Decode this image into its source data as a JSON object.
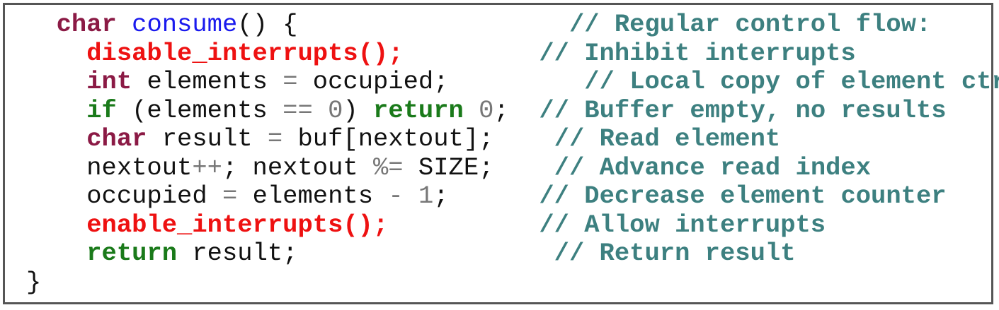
{
  "code_lines": [
    {
      "segments": [
        {
          "text": "  ",
          "kind": "plain"
        },
        {
          "text": "char",
          "kind": "kw-type"
        },
        {
          "text": " ",
          "kind": "plain"
        },
        {
          "text": "consume",
          "kind": "fn-name"
        },
        {
          "text": "() {                  ",
          "kind": "plain"
        },
        {
          "text": "// Regular control flow:",
          "kind": "comment"
        }
      ]
    },
    {
      "segments": [
        {
          "text": "    ",
          "kind": "plain"
        },
        {
          "text": "disable_interrupts();",
          "kind": "fn-red"
        },
        {
          "text": "         ",
          "kind": "plain"
        },
        {
          "text": "// Inhibit interrupts",
          "kind": "comment"
        }
      ]
    },
    {
      "segments": [
        {
          "text": "    ",
          "kind": "plain"
        },
        {
          "text": "int",
          "kind": "kw-type"
        },
        {
          "text": " elements ",
          "kind": "plain"
        },
        {
          "text": "=",
          "kind": "op"
        },
        {
          "text": " occupied;         ",
          "kind": "plain"
        },
        {
          "text": "// Local copy of element ctr",
          "kind": "comment"
        }
      ]
    },
    {
      "segments": [
        {
          "text": "    ",
          "kind": "plain"
        },
        {
          "text": "if",
          "kind": "kw-ctrl"
        },
        {
          "text": " (elements ",
          "kind": "plain"
        },
        {
          "text": "==",
          "kind": "op"
        },
        {
          "text": " ",
          "kind": "plain"
        },
        {
          "text": "0",
          "kind": "num"
        },
        {
          "text": ") ",
          "kind": "plain"
        },
        {
          "text": "return",
          "kind": "kw-ctrl"
        },
        {
          "text": " ",
          "kind": "plain"
        },
        {
          "text": "0",
          "kind": "num"
        },
        {
          "text": ";  ",
          "kind": "plain"
        },
        {
          "text": "// Buffer empty, no results",
          "kind": "comment"
        }
      ]
    },
    {
      "segments": [
        {
          "text": "    ",
          "kind": "plain"
        },
        {
          "text": "char",
          "kind": "kw-type"
        },
        {
          "text": " result ",
          "kind": "plain"
        },
        {
          "text": "=",
          "kind": "op"
        },
        {
          "text": " buf[nextout];    ",
          "kind": "plain"
        },
        {
          "text": "// Read element",
          "kind": "comment"
        }
      ]
    },
    {
      "segments": [
        {
          "text": "    nextout",
          "kind": "plain"
        },
        {
          "text": "++",
          "kind": "op"
        },
        {
          "text": "; nextout ",
          "kind": "plain"
        },
        {
          "text": "%=",
          "kind": "op"
        },
        {
          "text": " SIZE;    ",
          "kind": "plain"
        },
        {
          "text": "// Advance read index",
          "kind": "comment"
        }
      ]
    },
    {
      "segments": [
        {
          "text": "    occupied ",
          "kind": "plain"
        },
        {
          "text": "=",
          "kind": "op"
        },
        {
          "text": " elements ",
          "kind": "plain"
        },
        {
          "text": "-",
          "kind": "op"
        },
        {
          "text": " ",
          "kind": "plain"
        },
        {
          "text": "1",
          "kind": "num"
        },
        {
          "text": ";      ",
          "kind": "plain"
        },
        {
          "text": "// Decrease element counter",
          "kind": "comment"
        }
      ]
    },
    {
      "segments": [
        {
          "text": "    ",
          "kind": "plain"
        },
        {
          "text": "enable_interrupts();",
          "kind": "fn-red"
        },
        {
          "text": "          ",
          "kind": "plain"
        },
        {
          "text": "// Allow interrupts",
          "kind": "comment"
        }
      ]
    },
    {
      "segments": [
        {
          "text": "    ",
          "kind": "plain"
        },
        {
          "text": "return",
          "kind": "kw-ctrl"
        },
        {
          "text": " result;                 ",
          "kind": "plain"
        },
        {
          "text": "// Return result",
          "kind": "comment"
        }
      ]
    },
    {
      "segments": [
        {
          "text": "}",
          "kind": "plain"
        }
      ]
    }
  ],
  "colors": {
    "type_keyword": "#8b1a45",
    "control_keyword": "#1a7a1a",
    "function_name": "#1a1aee",
    "interrupt_call": "#ee1111",
    "comment": "#3d8080",
    "number_operator": "#777777",
    "plain_text": "#111111",
    "border": "#555555"
  }
}
